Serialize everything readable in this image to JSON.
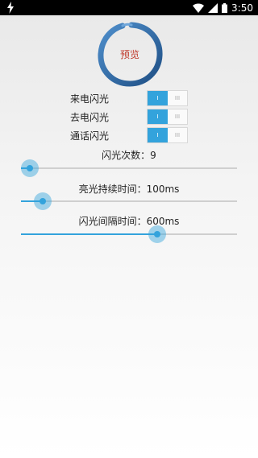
{
  "status_bar": {
    "time": "3:50",
    "left_icon": "bolt-icon",
    "right_icons": [
      "wifi-icon",
      "signal-icon",
      "battery-icon"
    ]
  },
  "preview": {
    "label": "预览",
    "ring_color": "#2c6aa8",
    "label_color": "#c0392b"
  },
  "toggles": [
    {
      "label": "来电闪光",
      "on_text": "I",
      "off_text": "III",
      "state": "on"
    },
    {
      "label": "去电闪光",
      "on_text": "I",
      "off_text": "III",
      "state": "on"
    },
    {
      "label": "通话闪光",
      "on_text": "I",
      "off_text": "III",
      "state": "on"
    }
  ],
  "sliders": [
    {
      "label": "闪光次数：9",
      "fraction": 0.04
    },
    {
      "label": "亮光持续时间：100ms",
      "fraction": 0.1
    },
    {
      "label": "闪光间隔时间：600ms",
      "fraction": 0.63
    }
  ],
  "colors": {
    "accent": "#33a3dc",
    "track": "#cfcfcf"
  }
}
